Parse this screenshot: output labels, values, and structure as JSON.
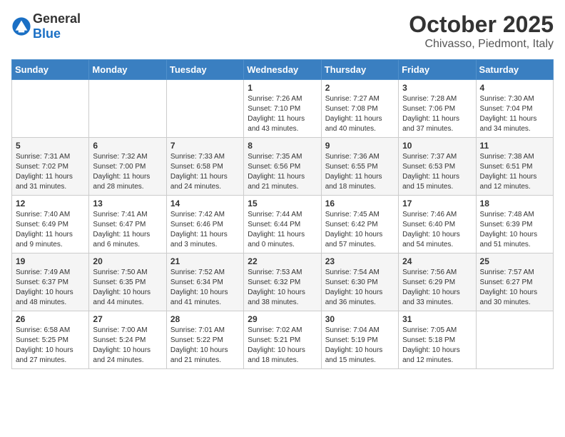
{
  "header": {
    "logo_general": "General",
    "logo_blue": "Blue",
    "month": "October 2025",
    "location": "Chivasso, Piedmont, Italy"
  },
  "weekdays": [
    "Sunday",
    "Monday",
    "Tuesday",
    "Wednesday",
    "Thursday",
    "Friday",
    "Saturday"
  ],
  "weeks": [
    [
      {
        "day": "",
        "info": ""
      },
      {
        "day": "",
        "info": ""
      },
      {
        "day": "",
        "info": ""
      },
      {
        "day": "1",
        "info": "Sunrise: 7:26 AM\nSunset: 7:10 PM\nDaylight: 11 hours\nand 43 minutes."
      },
      {
        "day": "2",
        "info": "Sunrise: 7:27 AM\nSunset: 7:08 PM\nDaylight: 11 hours\nand 40 minutes."
      },
      {
        "day": "3",
        "info": "Sunrise: 7:28 AM\nSunset: 7:06 PM\nDaylight: 11 hours\nand 37 minutes."
      },
      {
        "day": "4",
        "info": "Sunrise: 7:30 AM\nSunset: 7:04 PM\nDaylight: 11 hours\nand 34 minutes."
      }
    ],
    [
      {
        "day": "5",
        "info": "Sunrise: 7:31 AM\nSunset: 7:02 PM\nDaylight: 11 hours\nand 31 minutes."
      },
      {
        "day": "6",
        "info": "Sunrise: 7:32 AM\nSunset: 7:00 PM\nDaylight: 11 hours\nand 28 minutes."
      },
      {
        "day": "7",
        "info": "Sunrise: 7:33 AM\nSunset: 6:58 PM\nDaylight: 11 hours\nand 24 minutes."
      },
      {
        "day": "8",
        "info": "Sunrise: 7:35 AM\nSunset: 6:56 PM\nDaylight: 11 hours\nand 21 minutes."
      },
      {
        "day": "9",
        "info": "Sunrise: 7:36 AM\nSunset: 6:55 PM\nDaylight: 11 hours\nand 18 minutes."
      },
      {
        "day": "10",
        "info": "Sunrise: 7:37 AM\nSunset: 6:53 PM\nDaylight: 11 hours\nand 15 minutes."
      },
      {
        "day": "11",
        "info": "Sunrise: 7:38 AM\nSunset: 6:51 PM\nDaylight: 11 hours\nand 12 minutes."
      }
    ],
    [
      {
        "day": "12",
        "info": "Sunrise: 7:40 AM\nSunset: 6:49 PM\nDaylight: 11 hours\nand 9 minutes."
      },
      {
        "day": "13",
        "info": "Sunrise: 7:41 AM\nSunset: 6:47 PM\nDaylight: 11 hours\nand 6 minutes."
      },
      {
        "day": "14",
        "info": "Sunrise: 7:42 AM\nSunset: 6:46 PM\nDaylight: 11 hours\nand 3 minutes."
      },
      {
        "day": "15",
        "info": "Sunrise: 7:44 AM\nSunset: 6:44 PM\nDaylight: 11 hours\nand 0 minutes."
      },
      {
        "day": "16",
        "info": "Sunrise: 7:45 AM\nSunset: 6:42 PM\nDaylight: 10 hours\nand 57 minutes."
      },
      {
        "day": "17",
        "info": "Sunrise: 7:46 AM\nSunset: 6:40 PM\nDaylight: 10 hours\nand 54 minutes."
      },
      {
        "day": "18",
        "info": "Sunrise: 7:48 AM\nSunset: 6:39 PM\nDaylight: 10 hours\nand 51 minutes."
      }
    ],
    [
      {
        "day": "19",
        "info": "Sunrise: 7:49 AM\nSunset: 6:37 PM\nDaylight: 10 hours\nand 48 minutes."
      },
      {
        "day": "20",
        "info": "Sunrise: 7:50 AM\nSunset: 6:35 PM\nDaylight: 10 hours\nand 44 minutes."
      },
      {
        "day": "21",
        "info": "Sunrise: 7:52 AM\nSunset: 6:34 PM\nDaylight: 10 hours\nand 41 minutes."
      },
      {
        "day": "22",
        "info": "Sunrise: 7:53 AM\nSunset: 6:32 PM\nDaylight: 10 hours\nand 38 minutes."
      },
      {
        "day": "23",
        "info": "Sunrise: 7:54 AM\nSunset: 6:30 PM\nDaylight: 10 hours\nand 36 minutes."
      },
      {
        "day": "24",
        "info": "Sunrise: 7:56 AM\nSunset: 6:29 PM\nDaylight: 10 hours\nand 33 minutes."
      },
      {
        "day": "25",
        "info": "Sunrise: 7:57 AM\nSunset: 6:27 PM\nDaylight: 10 hours\nand 30 minutes."
      }
    ],
    [
      {
        "day": "26",
        "info": "Sunrise: 6:58 AM\nSunset: 5:25 PM\nDaylight: 10 hours\nand 27 minutes."
      },
      {
        "day": "27",
        "info": "Sunrise: 7:00 AM\nSunset: 5:24 PM\nDaylight: 10 hours\nand 24 minutes."
      },
      {
        "day": "28",
        "info": "Sunrise: 7:01 AM\nSunset: 5:22 PM\nDaylight: 10 hours\nand 21 minutes."
      },
      {
        "day": "29",
        "info": "Sunrise: 7:02 AM\nSunset: 5:21 PM\nDaylight: 10 hours\nand 18 minutes."
      },
      {
        "day": "30",
        "info": "Sunrise: 7:04 AM\nSunset: 5:19 PM\nDaylight: 10 hours\nand 15 minutes."
      },
      {
        "day": "31",
        "info": "Sunrise: 7:05 AM\nSunset: 5:18 PM\nDaylight: 10 hours\nand 12 minutes."
      },
      {
        "day": "",
        "info": ""
      }
    ]
  ]
}
